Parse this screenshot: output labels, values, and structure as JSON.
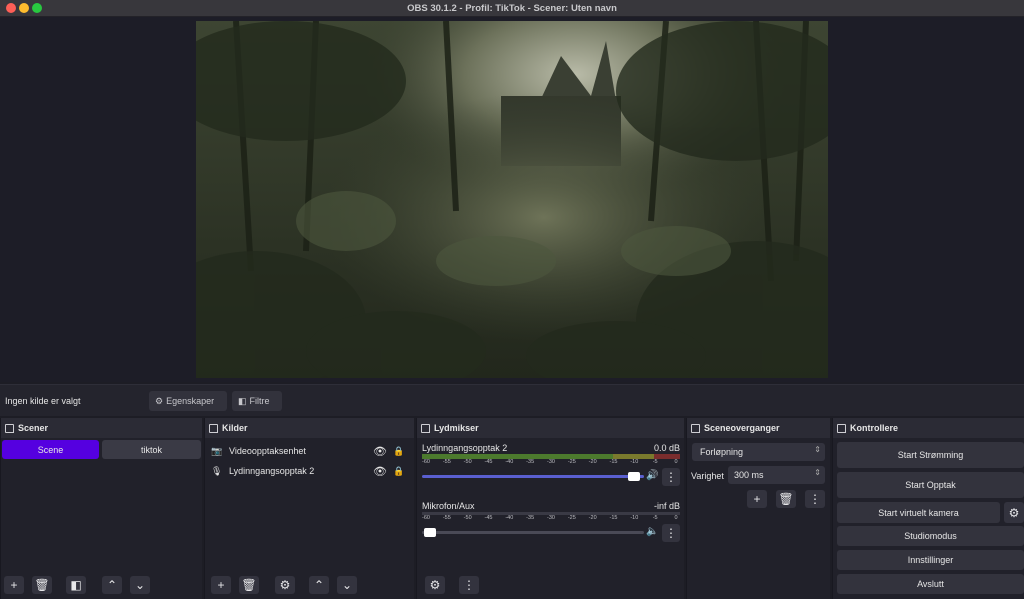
{
  "window": {
    "title": "OBS 30.1.2 - Profil: TikTok - Scener: Uten navn"
  },
  "context_bar": {
    "no_source": "Ingen kilde er valgt",
    "properties": "Egenskaper",
    "filters": "Filtre"
  },
  "scenes": {
    "title": "Scener",
    "items": [
      {
        "label": "Scene",
        "active": true
      },
      {
        "label": "tiktok",
        "active": false
      }
    ]
  },
  "sources": {
    "title": "Kilder",
    "items": [
      {
        "label": "Videoopptaksenhet",
        "icon": "camera-icon"
      },
      {
        "label": "Lydinngangsopptak 2",
        "icon": "microphone-icon"
      }
    ]
  },
  "mixer": {
    "title": "Lydmikser",
    "ticks": [
      "-60",
      "-55",
      "-50",
      "-45",
      "-40",
      "-35",
      "-30",
      "-25",
      "-20",
      "-15",
      "-10",
      "-5",
      "0"
    ],
    "channels": [
      {
        "name": "Lydinngangsopptak 2",
        "db": "0.0 dB",
        "volume": 1.0,
        "muted": false
      },
      {
        "name": "Mikrofon/Aux",
        "db": "-inf dB",
        "volume": 0.0,
        "muted": true
      }
    ]
  },
  "transitions": {
    "title": "Sceneoverganger",
    "selected": "Forløpning",
    "duration_label": "Varighet",
    "duration_value": "300 ms"
  },
  "controls": {
    "title": "Kontrollere",
    "start_stream": "Start Strømming",
    "start_record": "Start Opptak",
    "start_virtual_cam": "Start virtuelt kamera",
    "studio_mode": "Studiomodus",
    "settings": "Innstillinger",
    "exit": "Avslutt"
  },
  "colors": {
    "accent": "#5500e0",
    "volume_bar": "#5a5fd0",
    "traffic_close": "#fe5f57",
    "traffic_min": "#febc2e",
    "traffic_max": "#28c840"
  }
}
